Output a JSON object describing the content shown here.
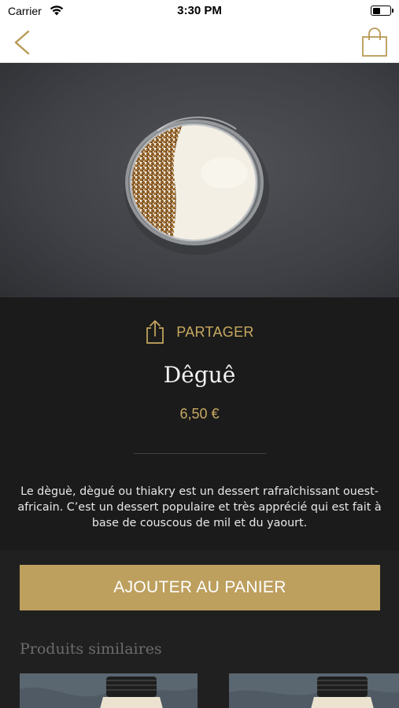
{
  "status_bar": {
    "carrier": "Carrier",
    "time": "3:30 PM"
  },
  "nav": {
    "back_icon": "chevron-left-icon",
    "cart_icon": "shopping-bag-icon",
    "accent_color": "#c8a961"
  },
  "product": {
    "image_icon": "degue-bowl-photo",
    "share_label": "PARTAGER",
    "share_icon": "share-icon",
    "name": "Dêguê",
    "price": "6,50 €",
    "description": "Le dèguè, dègué ou thiakry est un dessert rafraîchissant ouest-africain. C’est un dessert populaire et très apprécié qui est fait à base de couscous de mil et du yaourt."
  },
  "actions": {
    "add_to_cart_label": "AJOUTER AU PANIER",
    "button_color": "#bd9f5e"
  },
  "similar": {
    "title": "Produits similaires"
  }
}
